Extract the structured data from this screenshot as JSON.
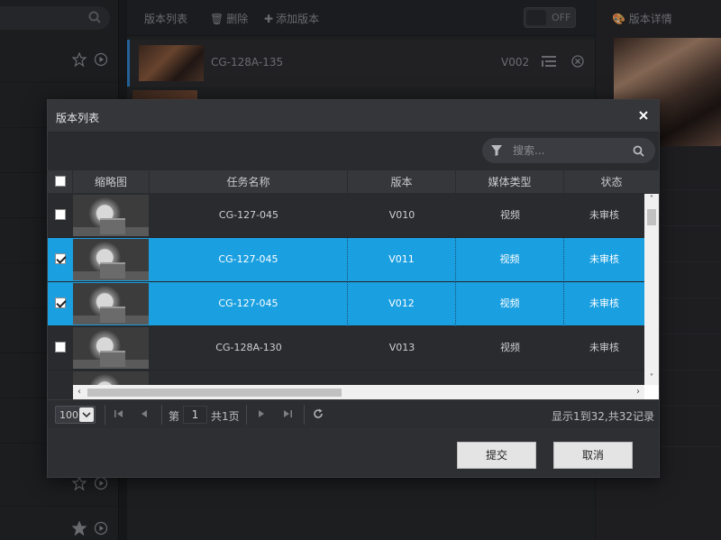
{
  "background": {
    "left_rows": [
      {
        "star": "outline"
      },
      {
        "star": "outline"
      },
      {
        "star": "outline"
      },
      {
        "star": "outline"
      },
      {
        "star": "outline"
      },
      {
        "star": "outline"
      },
      {
        "star": "outline"
      },
      {
        "star": "outline"
      },
      {
        "star": "outline"
      },
      {
        "star": "outline"
      },
      {
        "star": "outline"
      },
      {
        "star": "filled"
      }
    ],
    "toolbar": {
      "version_list_label": "版本列表",
      "delete_label": "删除",
      "add_version_label": "添加版本",
      "toggle_label": "OFF"
    },
    "version_row": {
      "name": "CG-128A-135",
      "version": "V002"
    },
    "right_panel": {
      "title": "版本详情"
    }
  },
  "dialog": {
    "title": "版本列表",
    "search_placeholder": "搜索...",
    "columns": [
      "缩略图",
      "任务名称",
      "版本",
      "媒体类型",
      "状态"
    ],
    "rows": [
      {
        "checked": false,
        "selected": false,
        "task": "CG-127-045",
        "version": "V010",
        "media": "视频",
        "status": "未审核"
      },
      {
        "checked": true,
        "selected": true,
        "task": "CG-127-045",
        "version": "V011",
        "media": "视频",
        "status": "未审核"
      },
      {
        "checked": true,
        "selected": true,
        "task": "CG-127-045",
        "version": "V012",
        "media": "视频",
        "status": "未审核"
      },
      {
        "checked": false,
        "selected": false,
        "task": "CG-128A-130",
        "version": "V013",
        "media": "视频",
        "status": "未审核"
      },
      {
        "checked": false,
        "selected": false,
        "task": "",
        "version": "",
        "media": "",
        "status": ""
      }
    ],
    "pager": {
      "page_size": "100",
      "page_prefix": "第",
      "current_page": "1",
      "page_total": "共1页",
      "record_info": "显示1到32,共32记录"
    },
    "buttons": {
      "submit": "提交",
      "cancel": "取消"
    }
  },
  "colors": {
    "accent": "#1a9fe0",
    "background": "#1e1f21",
    "dialog": "#2e2f33"
  }
}
